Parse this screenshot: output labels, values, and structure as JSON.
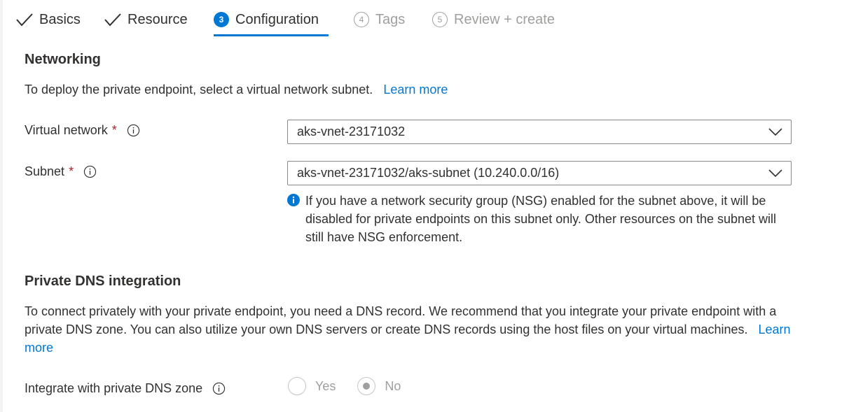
{
  "tabs": [
    {
      "label": "Basics",
      "state": "done",
      "icon": "checkmark-icon"
    },
    {
      "label": "Resource",
      "state": "done",
      "icon": "checkmark-icon"
    },
    {
      "label": "Configuration",
      "state": "active",
      "step": "3"
    },
    {
      "label": "Tags",
      "state": "todo",
      "step": "4"
    },
    {
      "label": "Review + create",
      "state": "todo",
      "step": "5"
    }
  ],
  "networking": {
    "title": "Networking",
    "description": "To deploy the private endpoint, select a virtual network subnet.",
    "learn_more": "Learn more",
    "virtual_network": {
      "label": "Virtual network",
      "required": "*",
      "value": "aks-vnet-23171032"
    },
    "subnet": {
      "label": "Subnet",
      "required": "*",
      "value": "aks-vnet-23171032/aks-subnet (10.240.0.0/16)"
    },
    "nsg_note": "If you have a network security group (NSG) enabled for the subnet above, it will be disabled for private endpoints on this subnet only. Other resources on the subnet will still have NSG enforcement."
  },
  "dns": {
    "title": "Private DNS integration",
    "description": "To connect privately with your private endpoint, you need a DNS record. We recommend that you integrate your private endpoint with a private DNS zone. You can also utilize your own DNS servers or create DNS records using the host files on your virtual machines.",
    "learn_more": "Learn more",
    "integrate_label": "Integrate with private DNS zone",
    "options": [
      "Yes",
      "No"
    ],
    "selected": "No"
  },
  "colors": {
    "accent": "#0078d4",
    "required": "#a4262c",
    "disabled": "#a19f9d"
  }
}
